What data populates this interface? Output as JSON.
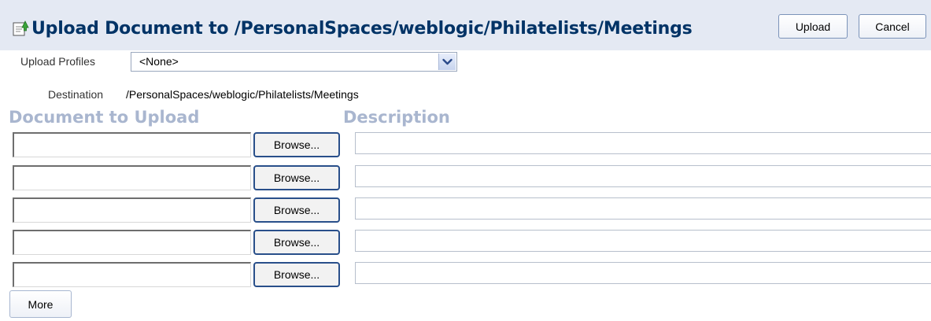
{
  "header": {
    "title": "Upload Document to /PersonalSpaces/weblogic/Philatelists/Meetings",
    "icon": "upload-document-icon",
    "upload_label": "Upload",
    "cancel_label": "Cancel"
  },
  "form": {
    "profiles_label": "Upload Profiles",
    "profiles_value": "<None>",
    "destination_label": "Destination",
    "destination_value": "/PersonalSpaces/weblogic/Philatelists/Meetings",
    "col_document": "Document to Upload",
    "col_description": "Description",
    "browse_label": "Browse...",
    "more_label": "More"
  },
  "colors": {
    "header_bg": "#e4e9f3",
    "title": "#003366",
    "column_heading": "#a9b6cf"
  }
}
